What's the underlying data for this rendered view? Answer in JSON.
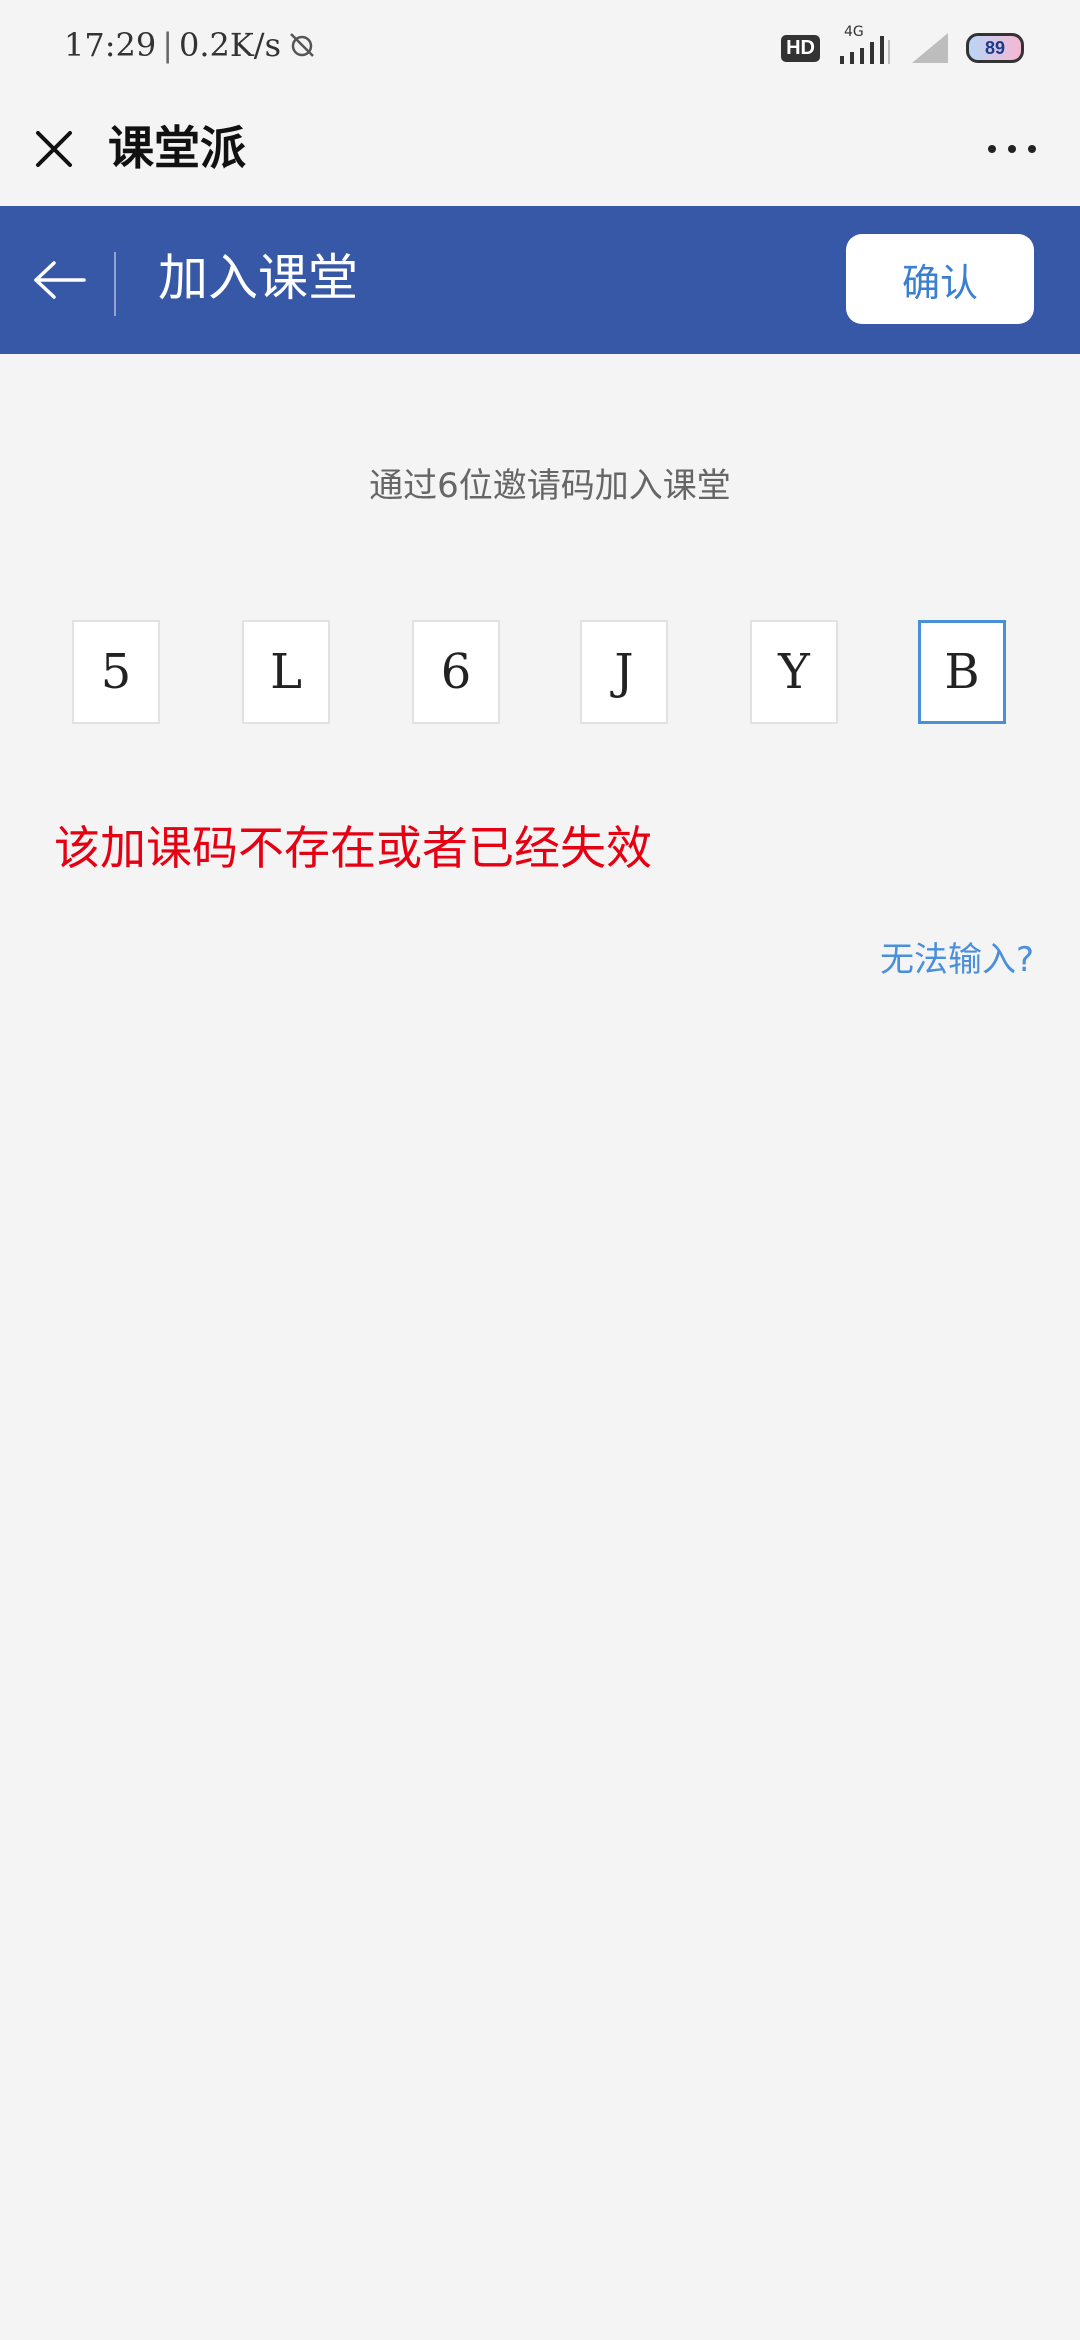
{
  "status_bar": {
    "time": "17:29",
    "separator": "|",
    "speed": "0.2K/s",
    "hd_label": "HD",
    "network_type": "4G",
    "battery_level": "89"
  },
  "app_header": {
    "title": "课堂派",
    "close_icon": "close-icon",
    "more_icon": "more-dots-icon"
  },
  "nav_bar": {
    "title": "加入课堂",
    "confirm_label": "确认",
    "back_icon": "arrow-left-icon",
    "background_color": "#3758a7"
  },
  "content": {
    "subtitle": "通过6位邀请码加入课堂",
    "code_chars": [
      "5",
      "L",
      "6",
      "J",
      "Y",
      "B"
    ],
    "error_message": "该加课码不存在或者已经失效",
    "help_link": "无法输入?",
    "error_color": "#e60012",
    "link_color": "#4a8fdc"
  }
}
